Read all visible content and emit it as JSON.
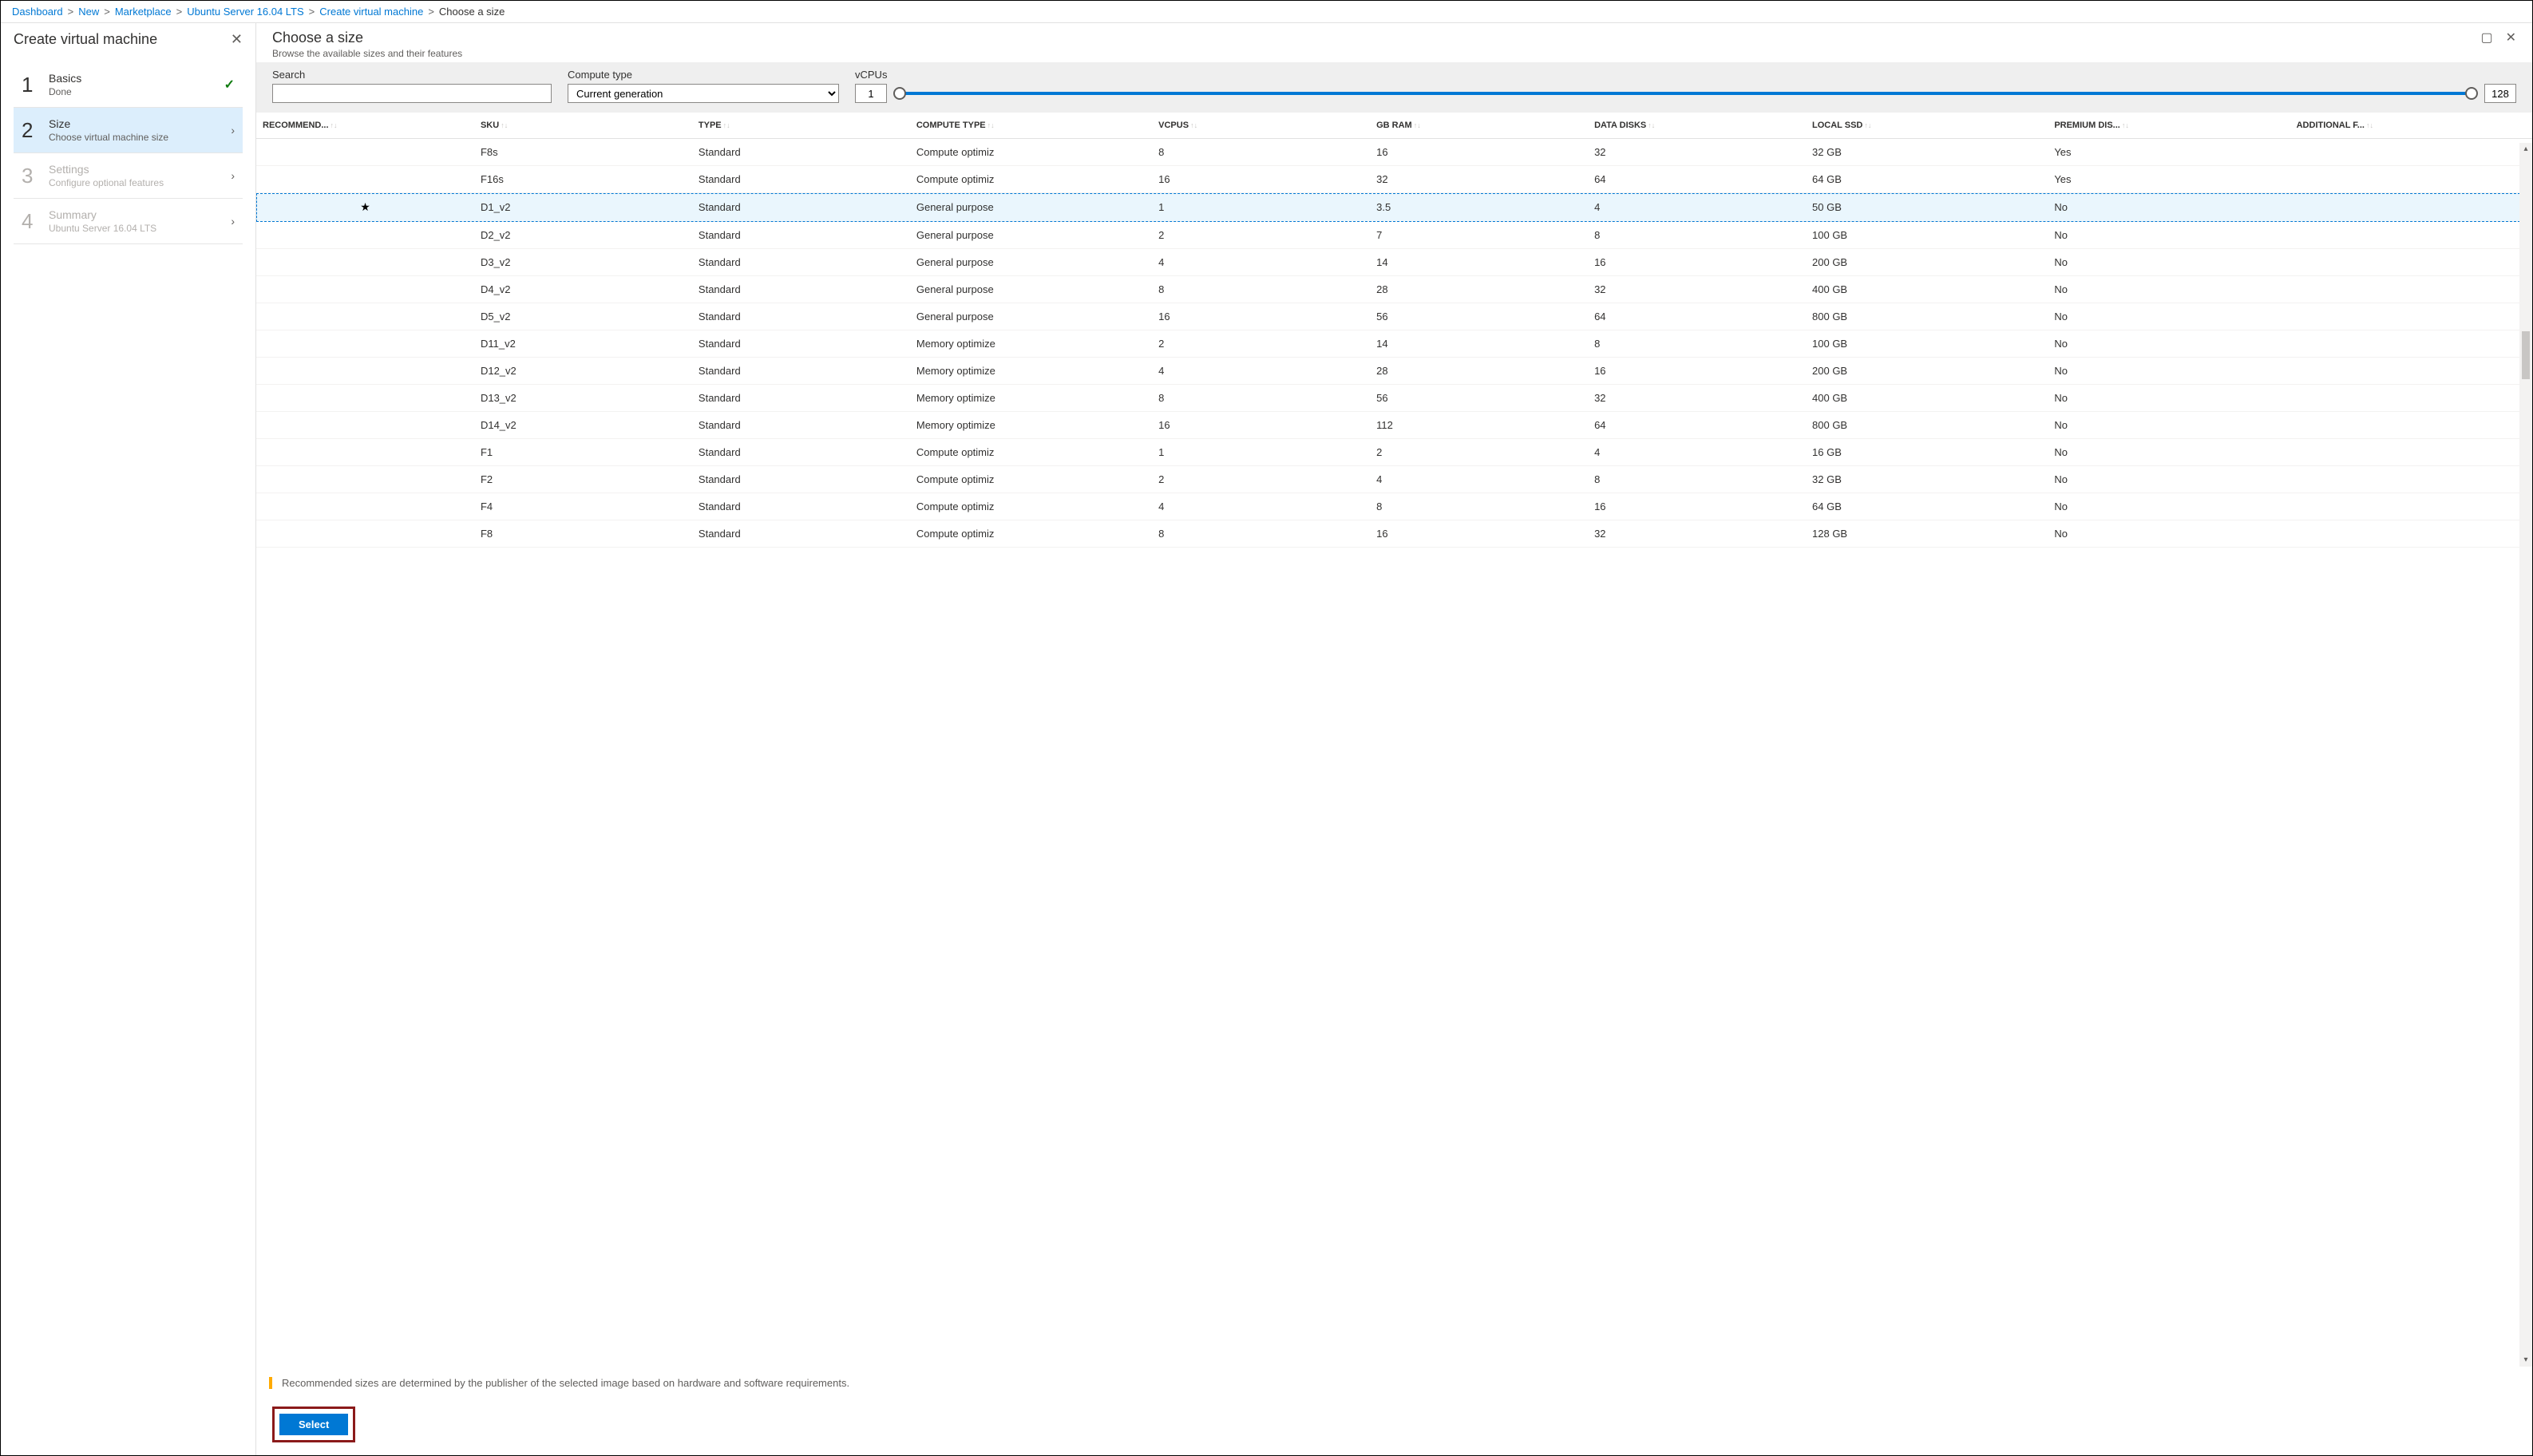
{
  "breadcrumb": {
    "items": [
      "Dashboard",
      "New",
      "Marketplace",
      "Ubuntu Server 16.04 LTS",
      "Create virtual machine"
    ],
    "current": "Choose a size"
  },
  "leftPanel": {
    "title": "Create virtual machine",
    "steps": [
      {
        "num": "1",
        "title": "Basics",
        "sub": "Done",
        "state": "done"
      },
      {
        "num": "2",
        "title": "Size",
        "sub": "Choose virtual machine size",
        "state": "active"
      },
      {
        "num": "3",
        "title": "Settings",
        "sub": "Configure optional features",
        "state": "disabled"
      },
      {
        "num": "4",
        "title": "Summary",
        "sub": "Ubuntu Server 16.04 LTS",
        "state": "disabled"
      }
    ]
  },
  "rightPanel": {
    "title": "Choose a size",
    "subtitle": "Browse the available sizes and their features"
  },
  "filters": {
    "searchLabel": "Search",
    "searchValue": "",
    "computeTypeLabel": "Compute type",
    "computeTypeValue": "Current generation",
    "vcpusLabel": "vCPUs",
    "vcpusMin": "1",
    "vcpusMax": "128"
  },
  "columns": [
    "RECOMMEND...",
    "SKU",
    "TYPE",
    "COMPUTE TYPE",
    "VCPUS",
    "GB RAM",
    "DATA DISKS",
    "LOCAL SSD",
    "PREMIUM DIS...",
    "ADDITIONAL F..."
  ],
  "rows": [
    {
      "rec": "",
      "sku": "F8s",
      "type": "Standard",
      "ctype": "Compute optimiz",
      "vcpus": "8",
      "ram": "16",
      "disks": "32",
      "ssd": "32 GB",
      "prem": "Yes",
      "sel": false
    },
    {
      "rec": "",
      "sku": "F16s",
      "type": "Standard",
      "ctype": "Compute optimiz",
      "vcpus": "16",
      "ram": "32",
      "disks": "64",
      "ssd": "64 GB",
      "prem": "Yes",
      "sel": false
    },
    {
      "rec": "★",
      "sku": "D1_v2",
      "type": "Standard",
      "ctype": "General purpose",
      "vcpus": "1",
      "ram": "3.5",
      "disks": "4",
      "ssd": "50 GB",
      "prem": "No",
      "sel": true
    },
    {
      "rec": "",
      "sku": "D2_v2",
      "type": "Standard",
      "ctype": "General purpose",
      "vcpus": "2",
      "ram": "7",
      "disks": "8",
      "ssd": "100 GB",
      "prem": "No",
      "sel": false
    },
    {
      "rec": "",
      "sku": "D3_v2",
      "type": "Standard",
      "ctype": "General purpose",
      "vcpus": "4",
      "ram": "14",
      "disks": "16",
      "ssd": "200 GB",
      "prem": "No",
      "sel": false
    },
    {
      "rec": "",
      "sku": "D4_v2",
      "type": "Standard",
      "ctype": "General purpose",
      "vcpus": "8",
      "ram": "28",
      "disks": "32",
      "ssd": "400 GB",
      "prem": "No",
      "sel": false
    },
    {
      "rec": "",
      "sku": "D5_v2",
      "type": "Standard",
      "ctype": "General purpose",
      "vcpus": "16",
      "ram": "56",
      "disks": "64",
      "ssd": "800 GB",
      "prem": "No",
      "sel": false
    },
    {
      "rec": "",
      "sku": "D11_v2",
      "type": "Standard",
      "ctype": "Memory optimize",
      "vcpus": "2",
      "ram": "14",
      "disks": "8",
      "ssd": "100 GB",
      "prem": "No",
      "sel": false
    },
    {
      "rec": "",
      "sku": "D12_v2",
      "type": "Standard",
      "ctype": "Memory optimize",
      "vcpus": "4",
      "ram": "28",
      "disks": "16",
      "ssd": "200 GB",
      "prem": "No",
      "sel": false
    },
    {
      "rec": "",
      "sku": "D13_v2",
      "type": "Standard",
      "ctype": "Memory optimize",
      "vcpus": "8",
      "ram": "56",
      "disks": "32",
      "ssd": "400 GB",
      "prem": "No",
      "sel": false
    },
    {
      "rec": "",
      "sku": "D14_v2",
      "type": "Standard",
      "ctype": "Memory optimize",
      "vcpus": "16",
      "ram": "112",
      "disks": "64",
      "ssd": "800 GB",
      "prem": "No",
      "sel": false
    },
    {
      "rec": "",
      "sku": "F1",
      "type": "Standard",
      "ctype": "Compute optimiz",
      "vcpus": "1",
      "ram": "2",
      "disks": "4",
      "ssd": "16 GB",
      "prem": "No",
      "sel": false
    },
    {
      "rec": "",
      "sku": "F2",
      "type": "Standard",
      "ctype": "Compute optimiz",
      "vcpus": "2",
      "ram": "4",
      "disks": "8",
      "ssd": "32 GB",
      "prem": "No",
      "sel": false
    },
    {
      "rec": "",
      "sku": "F4",
      "type": "Standard",
      "ctype": "Compute optimiz",
      "vcpus": "4",
      "ram": "8",
      "disks": "16",
      "ssd": "64 GB",
      "prem": "No",
      "sel": false
    },
    {
      "rec": "",
      "sku": "F8",
      "type": "Standard",
      "ctype": "Compute optimiz",
      "vcpus": "8",
      "ram": "16",
      "disks": "32",
      "ssd": "128 GB",
      "prem": "No",
      "sel": false
    }
  ],
  "infoText": "Recommended sizes are determined by the publisher of the selected image based on hardware and software requirements.",
  "selectLabel": "Select"
}
